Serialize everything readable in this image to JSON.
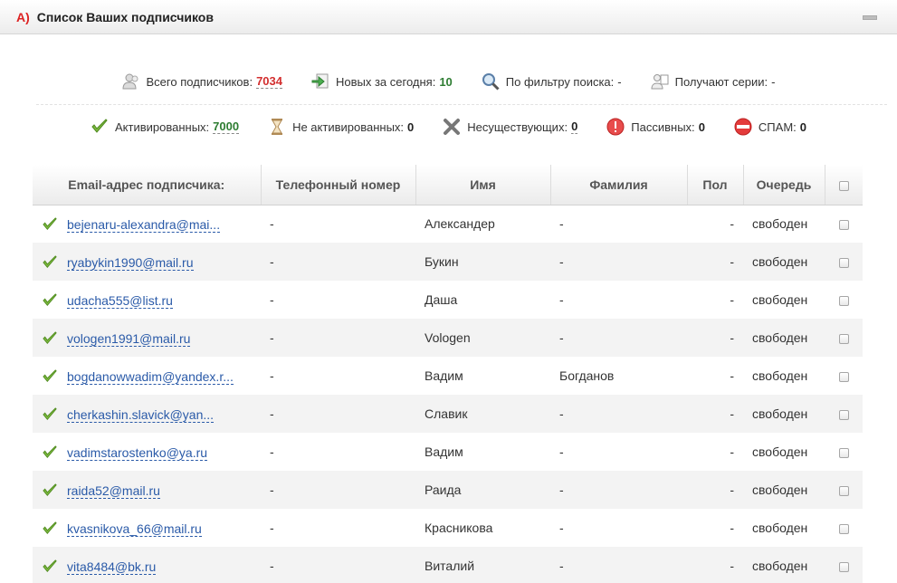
{
  "header": {
    "letter": "A)",
    "title": "Список Ваших подписчиков"
  },
  "stats_row1": [
    {
      "icon": "users-icon",
      "label": "Всего подписчиков:",
      "value": "7034",
      "style": "red"
    },
    {
      "icon": "new-arrow-icon",
      "label": "Новых за сегодня:",
      "value": "10",
      "style": "green"
    },
    {
      "icon": "magnifier-icon",
      "label": "По фильтру поиска:",
      "value": "-",
      "style": "plain"
    },
    {
      "icon": "series-users-icon",
      "label": "Получают серии:",
      "value": "-",
      "style": "plain"
    }
  ],
  "stats_row2": [
    {
      "icon": "checkmark-icon",
      "label": "Активированных:",
      "value": "7000",
      "style": "green"
    },
    {
      "icon": "hourglass-icon",
      "label": "Не активированных:",
      "value": "0",
      "style": "dark-nodash"
    },
    {
      "icon": "x-mark-icon",
      "label": "Несуществующих:",
      "value": "0",
      "style": "dark"
    },
    {
      "icon": "warning-icon",
      "label": "Пассивных:",
      "value": "0",
      "style": "dark-nodash"
    },
    {
      "icon": "spam-icon",
      "label": "СПАМ:",
      "value": "0",
      "style": "dark-nodash"
    }
  ],
  "table": {
    "headers": [
      "Email-адрес подписчика:",
      "Телефонный номер",
      "Имя",
      "Фамилия",
      "Пол",
      "Очередь"
    ],
    "rows": [
      {
        "email": "bejenaru-alexandra@mai...",
        "phone": "-",
        "first": "Александер",
        "last": "-",
        "gender": "-",
        "queue": "свободен"
      },
      {
        "email": "ryabykin1990@mail.ru",
        "phone": "-",
        "first": "Букин",
        "last": "-",
        "gender": "-",
        "queue": "свободен"
      },
      {
        "email": "udacha555@list.ru",
        "phone": "-",
        "first": "Даша",
        "last": "-",
        "gender": "-",
        "queue": "свободен"
      },
      {
        "email": "vologen1991@mail.ru",
        "phone": "-",
        "first": "Vologen",
        "last": "-",
        "gender": "-",
        "queue": "свободен"
      },
      {
        "email": "bogdanowwadim@yandex.r...",
        "phone": "-",
        "first": "Вадим",
        "last": "Богданов",
        "gender": "-",
        "queue": "свободен"
      },
      {
        "email": "cherkashin.slavick@yan...",
        "phone": "-",
        "first": "Славик",
        "last": "-",
        "gender": "-",
        "queue": "свободен"
      },
      {
        "email": "vadimstarostenko@ya.ru",
        "phone": "-",
        "first": "Вадим",
        "last": "-",
        "gender": "-",
        "queue": "свободен"
      },
      {
        "email": "raida52@mail.ru",
        "phone": "-",
        "first": "Раида",
        "last": "-",
        "gender": "-",
        "queue": "свободен"
      },
      {
        "email": "kvasnikova_66@mail.ru",
        "phone": "-",
        "first": "Красникова",
        "last": "-",
        "gender": "-",
        "queue": "свободен"
      },
      {
        "email": "vita8484@bk.ru",
        "phone": "-",
        "first": "Виталий",
        "last": "-",
        "gender": "-",
        "queue": "свободен"
      }
    ]
  },
  "colors": {
    "accent_red": "#d32f2f",
    "accent_green": "#2e7d32",
    "link_blue": "#2a5aa8"
  }
}
